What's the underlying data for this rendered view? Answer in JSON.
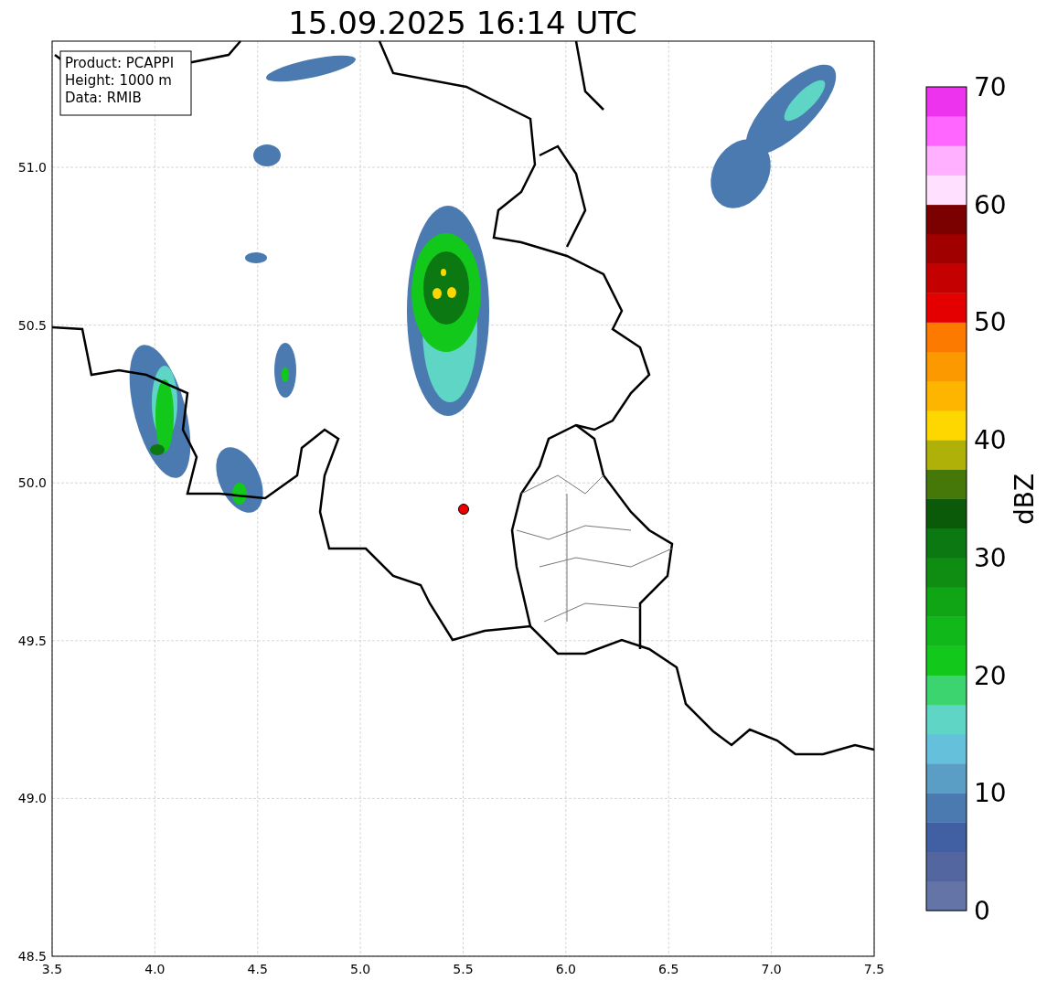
{
  "title": "15.09.2025 16:14 UTC",
  "info_box": [
    "Product: PCAPPI",
    "Height: 1000 m",
    "Data: RMIB"
  ],
  "x_ticks": [
    "3.5",
    "4.0",
    "4.5",
    "5.0",
    "5.5",
    "6.0",
    "6.5",
    "7.0",
    "7.5"
  ],
  "y_ticks": [
    "51.0",
    "50.5",
    "50.0",
    "49.5",
    "49.0",
    "48.5"
  ],
  "colorbar": {
    "label": "dBZ",
    "ticks": [
      "70",
      "60",
      "50",
      "40",
      "30",
      "20",
      "10",
      "0"
    ],
    "segments": [
      {
        "color": "#6474a6"
      },
      {
        "color": "#5466a0"
      },
      {
        "color": "#4160a4"
      },
      {
        "color": "#4b7ab1"
      },
      {
        "color": "#5a9dc5"
      },
      {
        "color": "#65c0db"
      },
      {
        "color": "#5fd5c5"
      },
      {
        "color": "#3bd46f"
      },
      {
        "color": "#12c81a"
      },
      {
        "color": "#10b81a"
      },
      {
        "color": "#10a515"
      },
      {
        "color": "#0e8d12"
      },
      {
        "color": "#0c7812"
      },
      {
        "color": "#0a5a0a"
      },
      {
        "color": "#467709"
      },
      {
        "color": "#afb109"
      },
      {
        "color": "#fed700"
      },
      {
        "color": "#fdb500"
      },
      {
        "color": "#fd9900"
      },
      {
        "color": "#fd7a00"
      },
      {
        "color": "#e40000"
      },
      {
        "color": "#c40000"
      },
      {
        "color": "#a00000"
      },
      {
        "color": "#7b0000"
      },
      {
        "color": "#ffe0ff"
      },
      {
        "color": "#ffb0ff"
      },
      {
        "color": "#ff66ff"
      },
      {
        "color": "#ee33ee"
      }
    ]
  }
}
